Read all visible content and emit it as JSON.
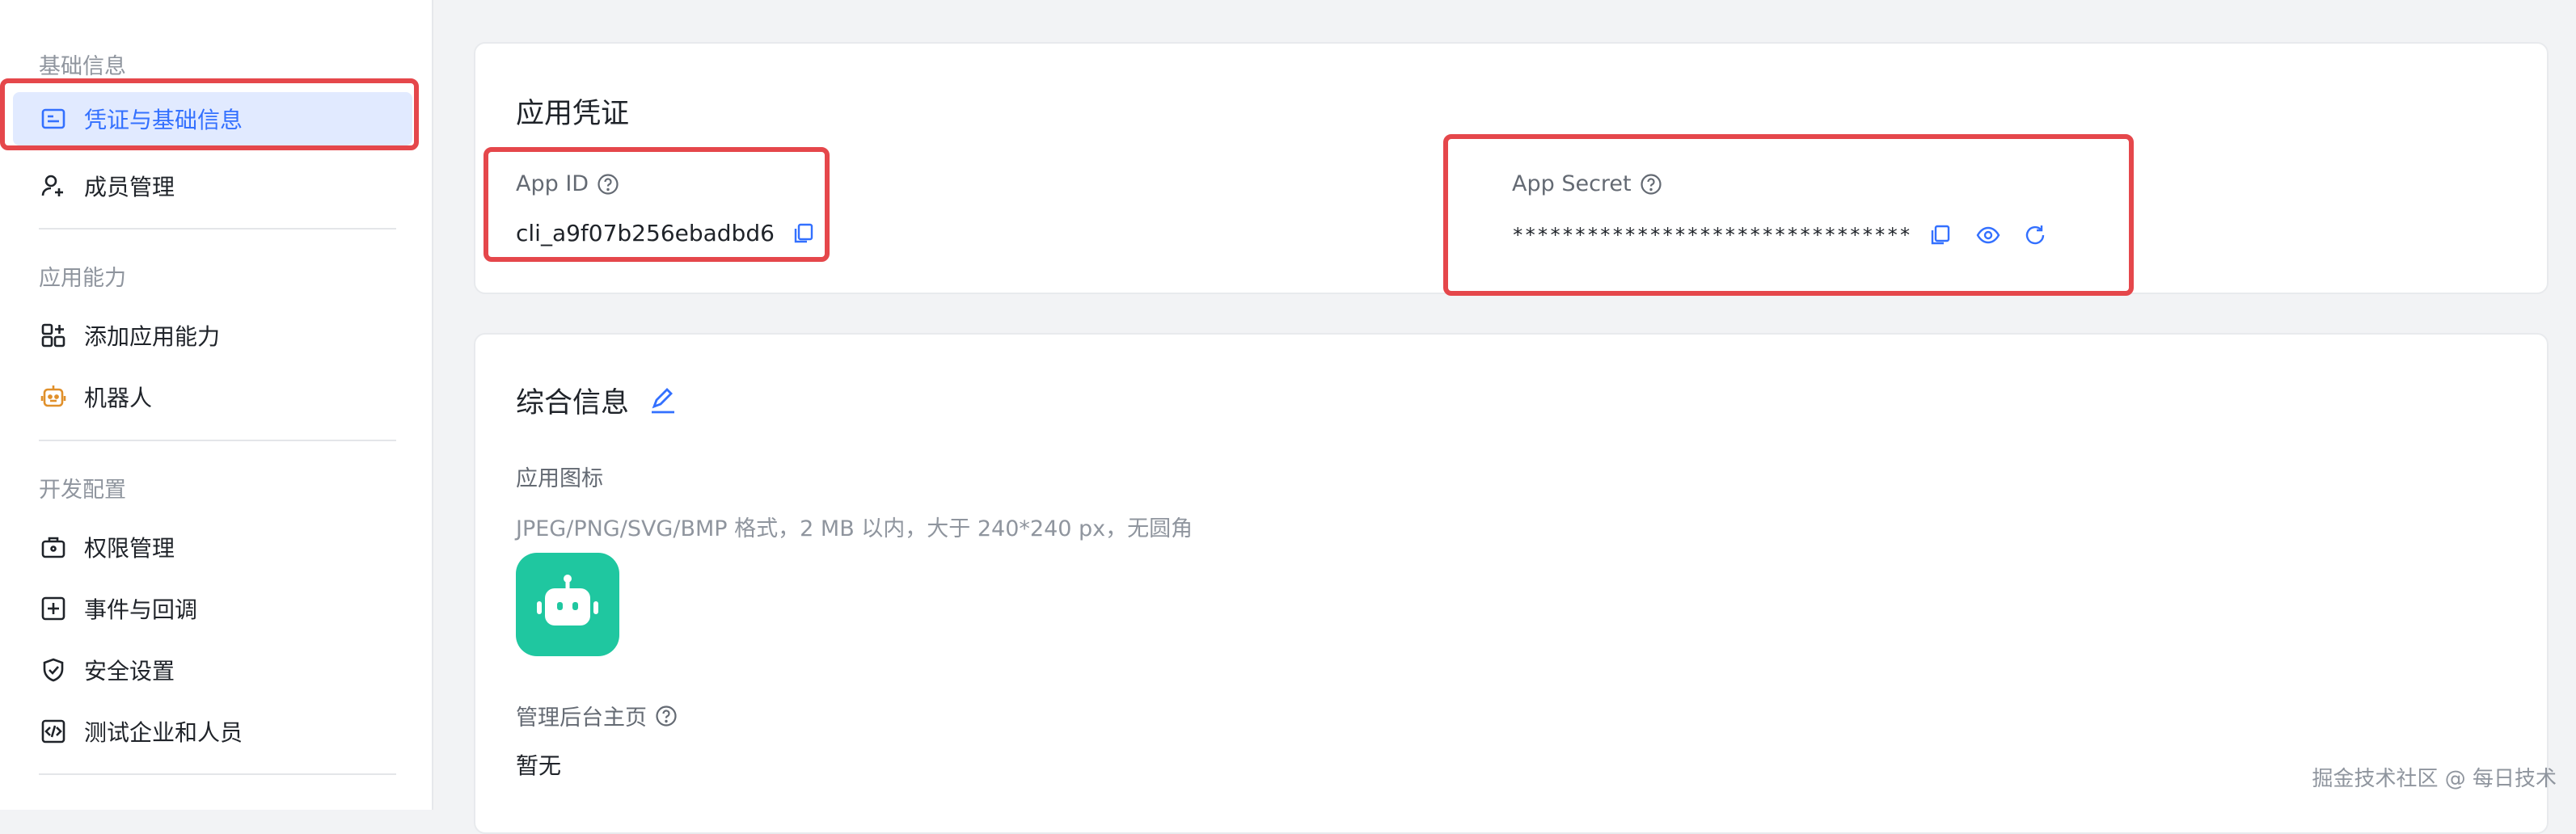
{
  "sidebar": {
    "sections": [
      {
        "title": "基础信息",
        "items": [
          {
            "label": "凭证与基础信息",
            "icon": "id-card-icon",
            "active": true
          },
          {
            "label": "成员管理",
            "icon": "user-add-icon"
          }
        ]
      },
      {
        "title": "应用能力",
        "items": [
          {
            "label": "添加应用能力",
            "icon": "apps-add-icon"
          },
          {
            "label": "机器人",
            "icon": "robot-icon"
          }
        ]
      },
      {
        "title": "开发配置",
        "items": [
          {
            "label": "权限管理",
            "icon": "briefcase-lock-icon"
          },
          {
            "label": "事件与回调",
            "icon": "event-icon"
          },
          {
            "label": "安全设置",
            "icon": "shield-icon"
          },
          {
            "label": "测试企业和人员",
            "icon": "code-icon"
          }
        ]
      }
    ]
  },
  "credentials": {
    "title": "应用凭证",
    "app_id_label": "App ID",
    "app_id_value": "cli_a9f07b256ebadbd6",
    "app_secret_label": "App Secret",
    "app_secret_value": "********************************"
  },
  "info": {
    "title": "综合信息",
    "icon_label": "应用图标",
    "icon_hint": "JPEG/PNG/SVG/BMP 格式，2 MB 以内，大于 240*240 px，无圆角",
    "admin_home_label": "管理后台主页",
    "admin_home_value": "暂无"
  },
  "watermark": "掘金技术社区 @ 每日技术",
  "colors": {
    "accent": "#3370ff",
    "highlight": "#e5474b",
    "app_icon": "#1fc7a0"
  }
}
